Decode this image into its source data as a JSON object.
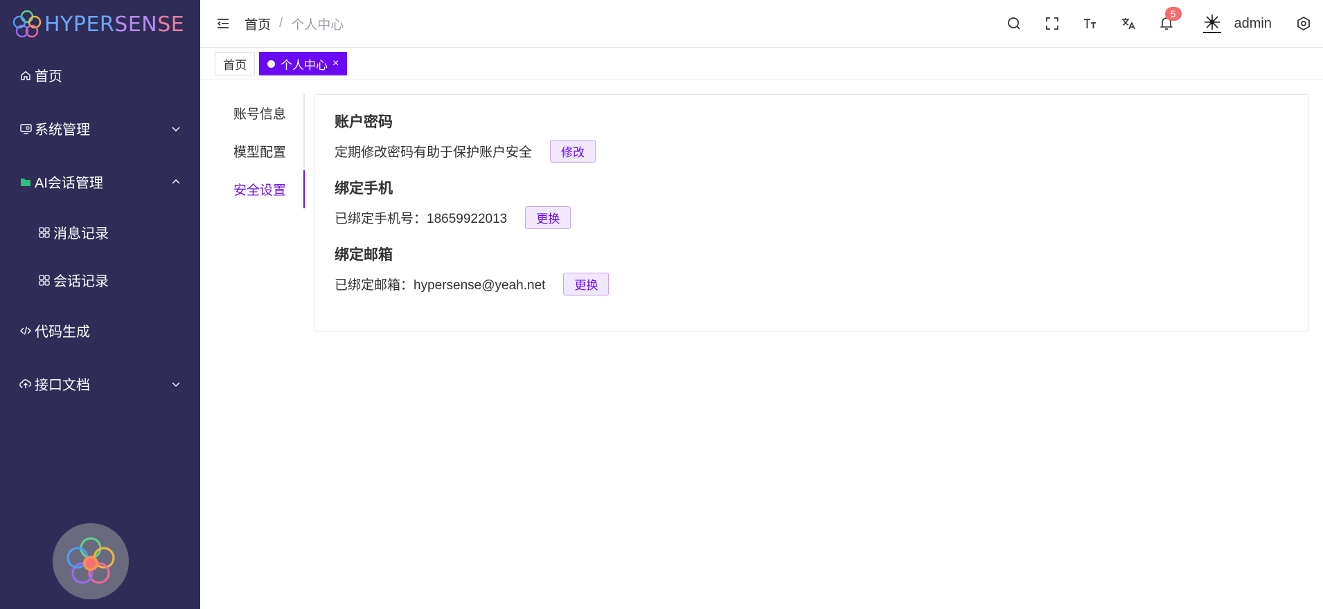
{
  "logo": {
    "text_part1": "HYPER",
    "text_part2": "SEN",
    "text_part3": "SE"
  },
  "sidebar": {
    "items": [
      {
        "label": "首页",
        "icon": "home-icon"
      },
      {
        "label": "系统管理",
        "icon": "monitor-icon",
        "expanded": false
      },
      {
        "label": "AI会话管理",
        "icon": "folder-icon",
        "expanded": true
      },
      {
        "label": "消息记录",
        "icon": "grid-icon"
      },
      {
        "label": "会话记录",
        "icon": "grid-icon"
      },
      {
        "label": "代码生成",
        "icon": "code-icon"
      },
      {
        "label": "接口文档",
        "icon": "cloud-icon",
        "expanded": false
      }
    ]
  },
  "header": {
    "breadcrumb_home": "首页",
    "breadcrumb_sep": "/",
    "breadcrumb_current": "个人中心",
    "notification_count": "5",
    "username": "admin"
  },
  "tabs": [
    {
      "label": "首页",
      "active": false
    },
    {
      "label": "个人中心",
      "active": true,
      "close": "×"
    }
  ],
  "profile_tabs": [
    {
      "label": "账号信息",
      "active": false
    },
    {
      "label": "模型配置",
      "active": false
    },
    {
      "label": "安全设置",
      "active": true
    }
  ],
  "security": {
    "password": {
      "title": "账户密码",
      "desc": "定期修改密码有助于保护账户安全",
      "button": "修改"
    },
    "phone": {
      "title": "绑定手机",
      "desc": "已绑定手机号：18659922013",
      "button": "更换"
    },
    "email": {
      "title": "绑定邮箱",
      "desc": "已绑定邮箱：hypersense@yeah.net",
      "button": "更换"
    }
  },
  "colors": {
    "sidebar_bg": "#2f2c57",
    "accent": "#6a0af5",
    "badge": "#f56c6c"
  }
}
